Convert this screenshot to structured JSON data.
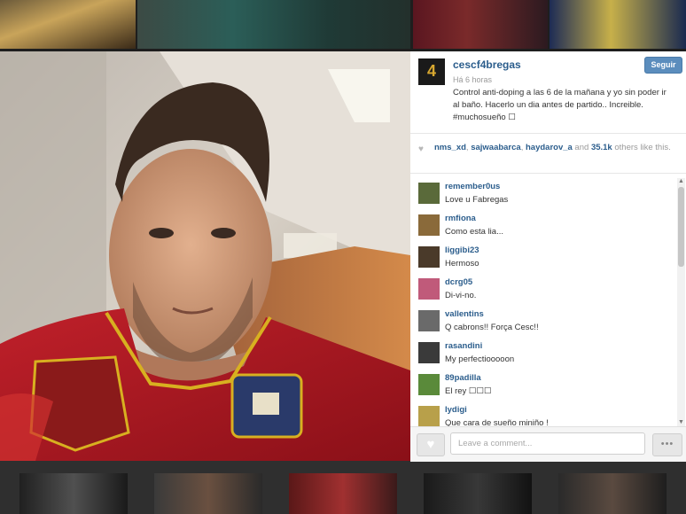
{
  "post": {
    "username": "cescf4bregas",
    "time": "Há 6 horas",
    "caption": "Control anti-doping a las 6 de la mañana y yo sin poder ir al baño. Hacerlo un dia antes de partido.. Increible. #muchosueño ☐",
    "follow_label": "Seguir",
    "avatar_glyph": "4"
  },
  "likes": {
    "users": [
      "nms_xd",
      "sajwaabarca",
      "haydarov_a"
    ],
    "sep1": ", ",
    "sep2": ", ",
    "and_text": " and ",
    "count": "35.1k",
    "suffix": " others like this."
  },
  "comments": [
    {
      "user": "remember0us",
      "text": "Love u Fabregas",
      "avatar_color": "#5a6a3a"
    },
    {
      "user": "rmfiona",
      "text": "Como esta lia...",
      "avatar_color": "#8a6a3a"
    },
    {
      "user": "liggibi23",
      "text": "Hermoso",
      "avatar_color": "#4a3a2a"
    },
    {
      "user": "dcrg05",
      "text": "Di-vi-no.",
      "avatar_color": "#c05a7a"
    },
    {
      "user": "vallentins",
      "text": "Q cabrons!! Força Cesc!!",
      "avatar_color": "#6a6a6a"
    },
    {
      "user": "rasandini",
      "text": "My perfectiooooon",
      "avatar_color": "#3a3a3a"
    },
    {
      "user": "89padilla",
      "text": "El rey ☐☐☐",
      "avatar_color": "#5a8a3a"
    },
    {
      "user": "lydigi",
      "text": "Que cara de sueño miniño !",
      "avatar_color": "#b8a04a"
    }
  ],
  "footer": {
    "comment_placeholder": "Leave a comment...",
    "more_label": "•••",
    "like_glyph": "♥"
  },
  "colors": {
    "link": "#2b5d8c",
    "follow_button": "#5b8dbd"
  }
}
